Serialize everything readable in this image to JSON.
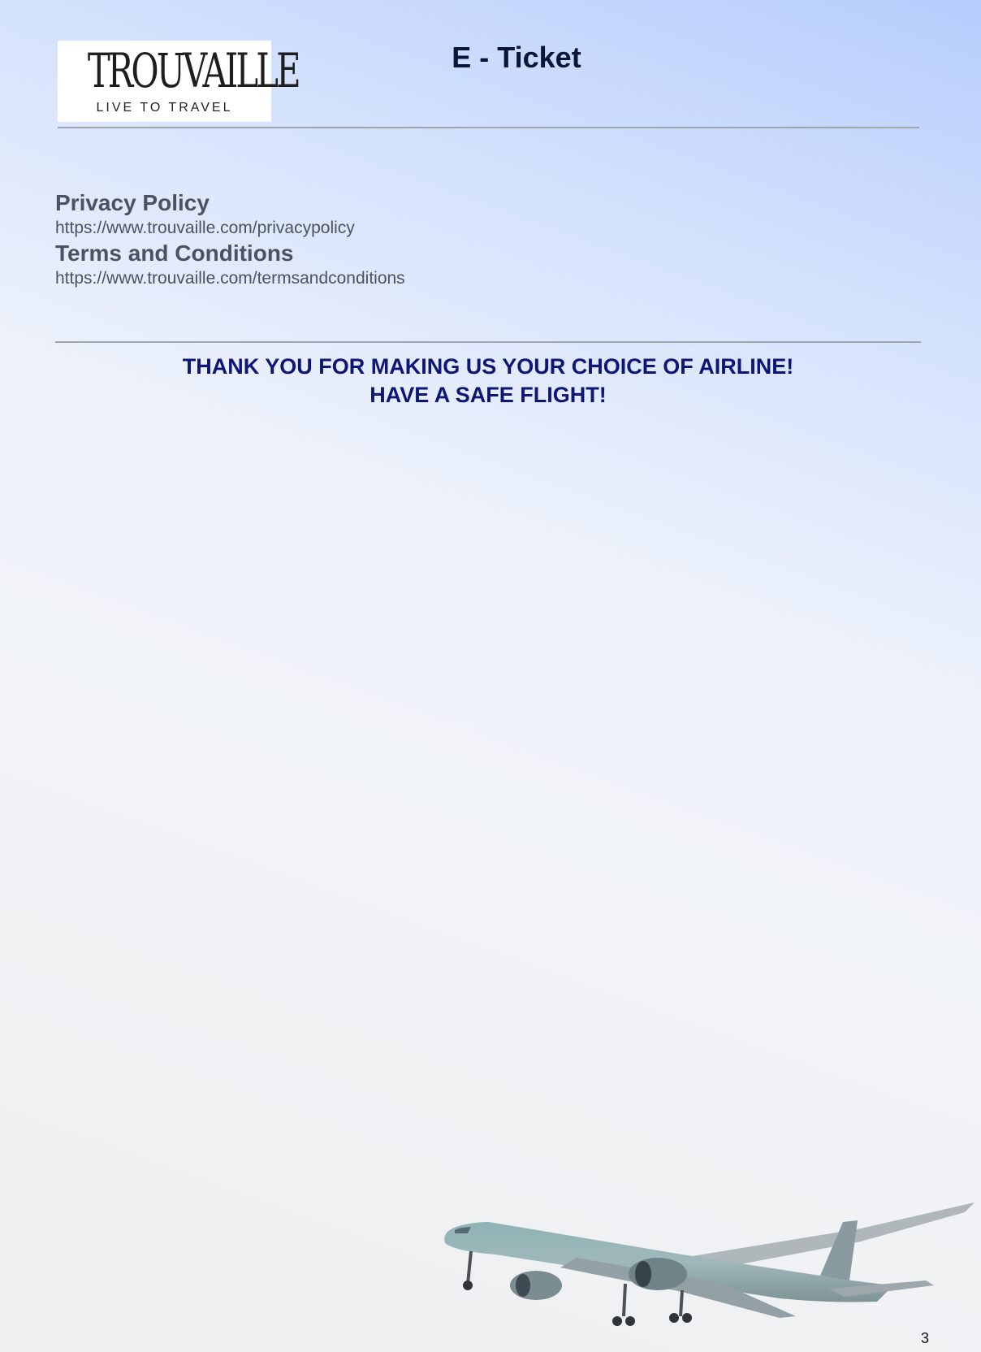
{
  "header": {
    "logo_word": "TROUVAILLE",
    "logo_tagline": "LIVE TO TRAVEL",
    "title": "E - Ticket"
  },
  "links": [
    {
      "heading": "Privacy Policy",
      "url": "https://www.trouvaille.com/privacypolicy"
    },
    {
      "heading": "Terms and Conditions",
      "url": "https://www.trouvaille.com/termsandconditions"
    }
  ],
  "thanks": {
    "line1": "THANK YOU FOR MAKING US YOUR CHOICE OF AIRLINE!",
    "line2": "HAVE A SAFE FLIGHT!"
  },
  "footer": {
    "page_number": "3"
  },
  "colors": {
    "thanks_text": "#0d1577",
    "link_text": "#4c5360",
    "title_text": "#0a1636",
    "gradient_top": "#b6cdfd",
    "gradient_bottom": "#efefef"
  },
  "icons": {
    "background_plane": "airplane-illustration"
  }
}
